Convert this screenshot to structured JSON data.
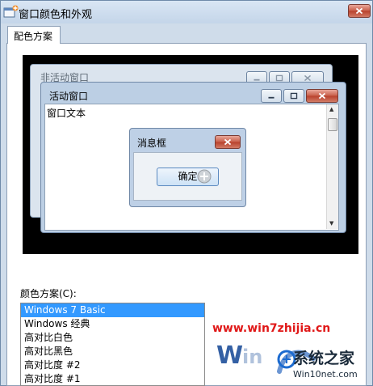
{
  "window": {
    "title": "窗口颜色和外观"
  },
  "tabs": [
    {
      "label": "配色方案",
      "active": true
    }
  ],
  "preview": {
    "inactive_window_title": "非活动窗口",
    "active_window_title": "活动窗口",
    "window_text": "窗口文本",
    "message_box": {
      "title": "消息框",
      "ok_label": "确定"
    }
  },
  "color_scheme": {
    "label": "颜色方案(C):",
    "items": [
      {
        "label": "Windows 7 Basic",
        "selected": true
      },
      {
        "label": "Windows 经典",
        "selected": false
      },
      {
        "label": "高对比白色",
        "selected": false
      },
      {
        "label": "高对比黑色",
        "selected": false
      },
      {
        "label": "高对比度 #2",
        "selected": false
      },
      {
        "label": "高对比度 #1",
        "selected": false
      }
    ]
  },
  "watermark": {
    "url": "www.win7zhijia.cn",
    "brand_cn": "系统之家",
    "brand_url": "Win10net.com"
  },
  "colors": {
    "dialog_bg": "#cfdcea",
    "selection": "#3399ff",
    "watermark_red": "#e01818"
  }
}
